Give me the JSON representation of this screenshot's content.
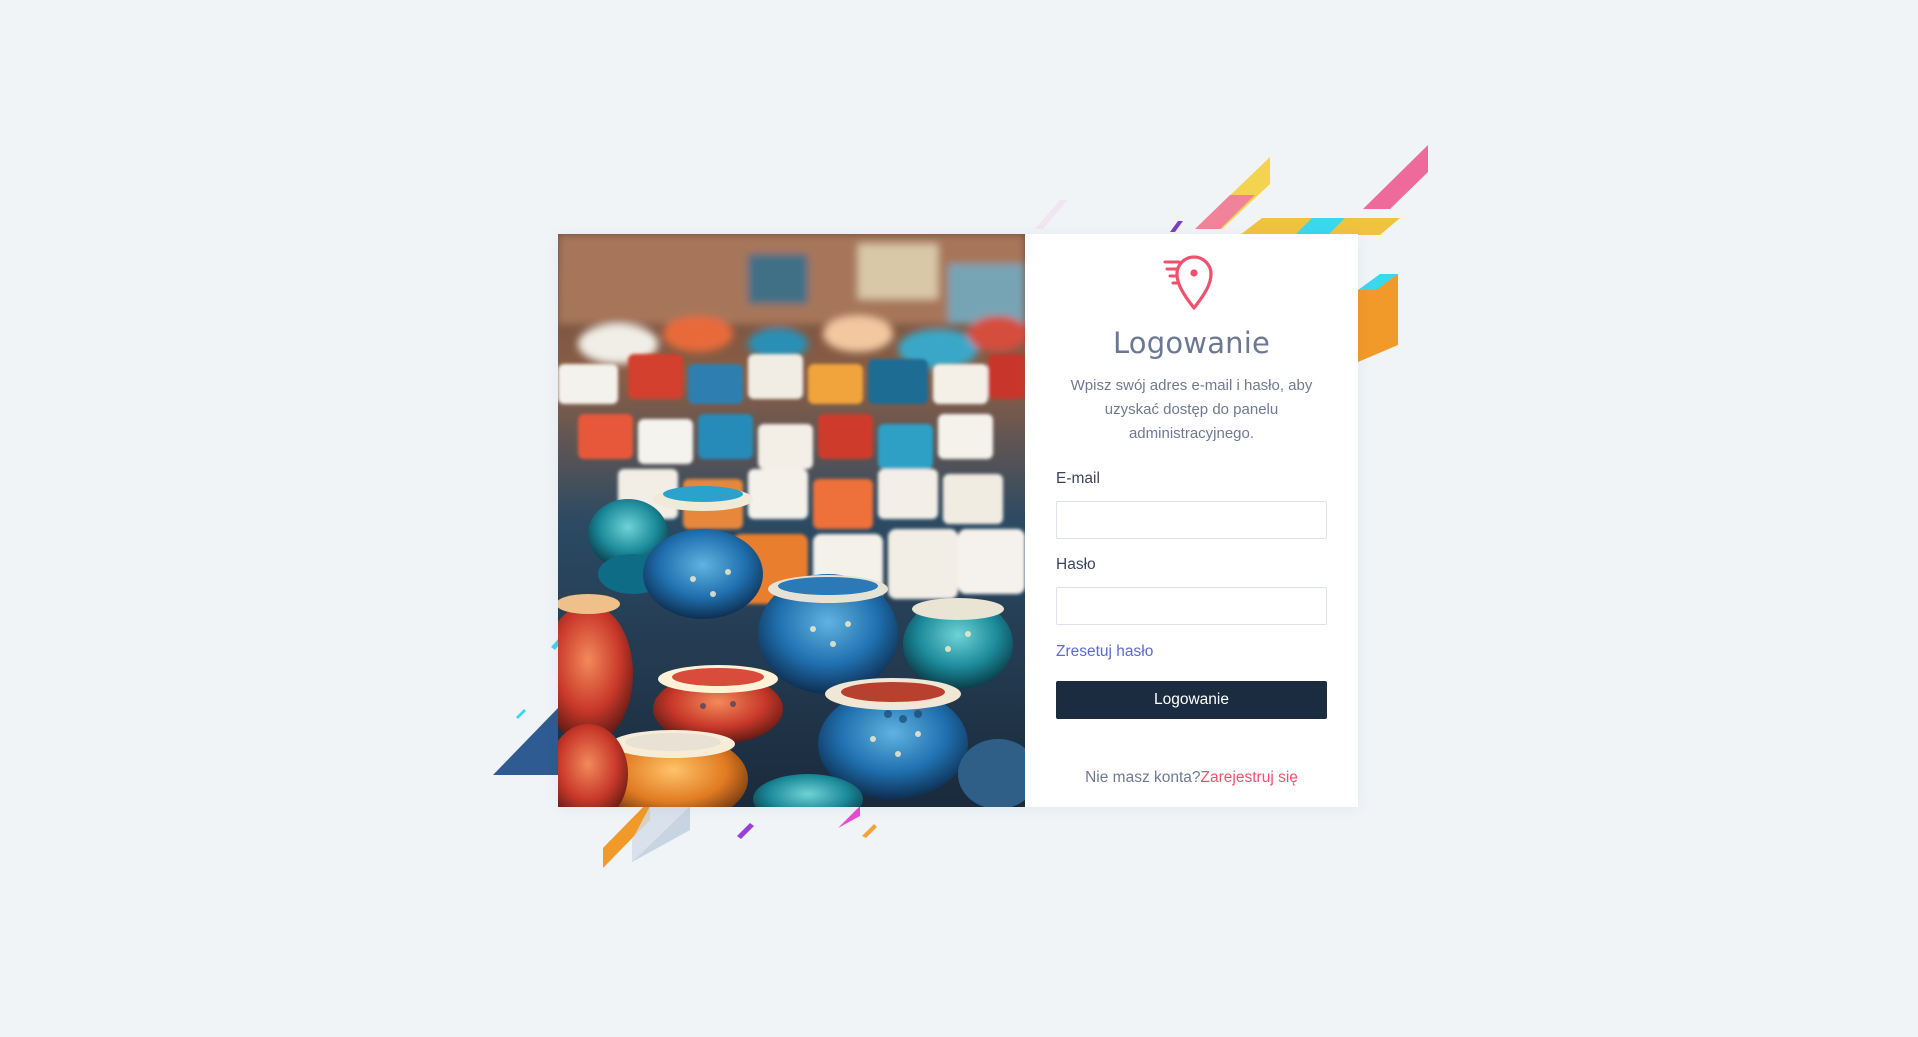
{
  "login": {
    "title": "Logowanie",
    "subtitle": "Wpisz swój adres e-mail i hasło, aby uzyskać dostęp do panelu administracyjnego.",
    "email_label": "E-mail",
    "email_value": "",
    "password_label": "Hasło",
    "password_value": "",
    "reset_link": "Zresetuj hasło",
    "submit_label": "Logowanie",
    "no_account_text": "Nie masz konta?",
    "register_link": "Zarejestruj się"
  },
  "icons": {
    "logo": "location-pin-speed-icon"
  },
  "colors": {
    "page_background": "#f0f4f7",
    "button_background": "#1b2b40",
    "accent_pink": "#f0506e",
    "link_blue": "#5a6bd0",
    "text_muted": "#6e7a92"
  }
}
